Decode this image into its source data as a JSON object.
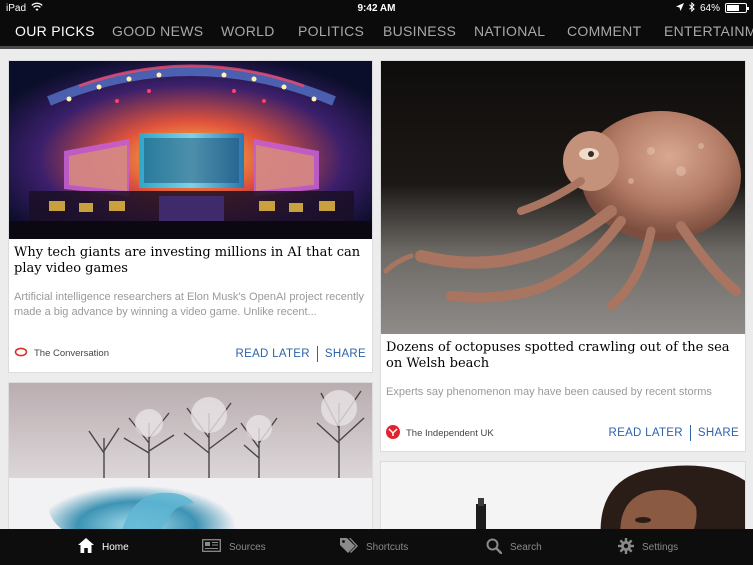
{
  "status": {
    "device": "iPad",
    "time": "9:42 AM",
    "battery": "64%",
    "battery_level": 0.64
  },
  "tabs": [
    {
      "label": "OUR PICKS",
      "active": true
    },
    {
      "label": "GOOD NEWS"
    },
    {
      "label": "WORLD"
    },
    {
      "label": "POLITICS"
    },
    {
      "label": "BUSINESS"
    },
    {
      "label": "NATIONAL"
    },
    {
      "label": "COMMENT"
    },
    {
      "label": "ENTERTAINMENT"
    }
  ],
  "cards": {
    "ai": {
      "title": "Why tech giants are investing millions in AI that can play video games",
      "desc": "Artificial intelligence researchers at Elon Musk's OpenAI project recently made a big advance by winning a video game. Unlike recent...",
      "source": "The Conversation",
      "read_later": "READ LATER",
      "share": "SHARE"
    },
    "octopus": {
      "title": "Dozens of octopuses spotted crawling out of the sea on Welsh beach",
      "desc": "Experts say phenomenon may have been caused by recent storms",
      "source": "The Independent UK",
      "read_later": "READ LATER",
      "share": "SHARE"
    }
  },
  "bottom_nav": [
    {
      "label": "Home",
      "icon": "home-icon",
      "active": true
    },
    {
      "label": "Sources",
      "icon": "newspaper-icon"
    },
    {
      "label": "Shortcuts",
      "icon": "tags-icon"
    },
    {
      "label": "Search",
      "icon": "search-icon"
    },
    {
      "label": "Settings",
      "icon": "gear-icon"
    }
  ],
  "colors": {
    "accent_link": "#2d63a8",
    "nav_bg": "#0b0b0b",
    "conversation_brand": "#d8322b",
    "independent_brand": "#e0242d"
  }
}
